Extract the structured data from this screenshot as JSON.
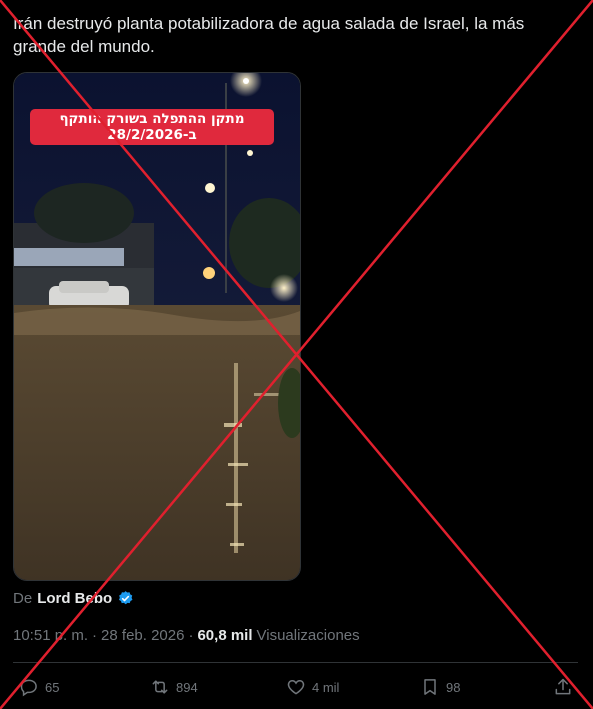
{
  "tweet": {
    "text": "Irán destruyó planta potabilizadora de agua salada de Israel, la más grande del mundo.",
    "video_banner_line1": "מתקן ההתפלה בשורק הותקף",
    "video_banner_line2": "ב-28/2/2026"
  },
  "attribution": {
    "prefix": "De",
    "author": "Lord Bebo"
  },
  "meta": {
    "time": "10:51 p. m.",
    "separator": "·",
    "date": "28 feb. 2026",
    "views_count": "60,8 mil",
    "views_label": "Visualizaciones"
  },
  "actions": {
    "replies": "65",
    "reposts": "894",
    "likes": "4 mil",
    "bookmarks": "98"
  },
  "colors": {
    "background": "#000000",
    "text": "#e7e9ea",
    "muted": "#71767b",
    "verified": "#1d9bf0",
    "cross": "#e0202e"
  }
}
